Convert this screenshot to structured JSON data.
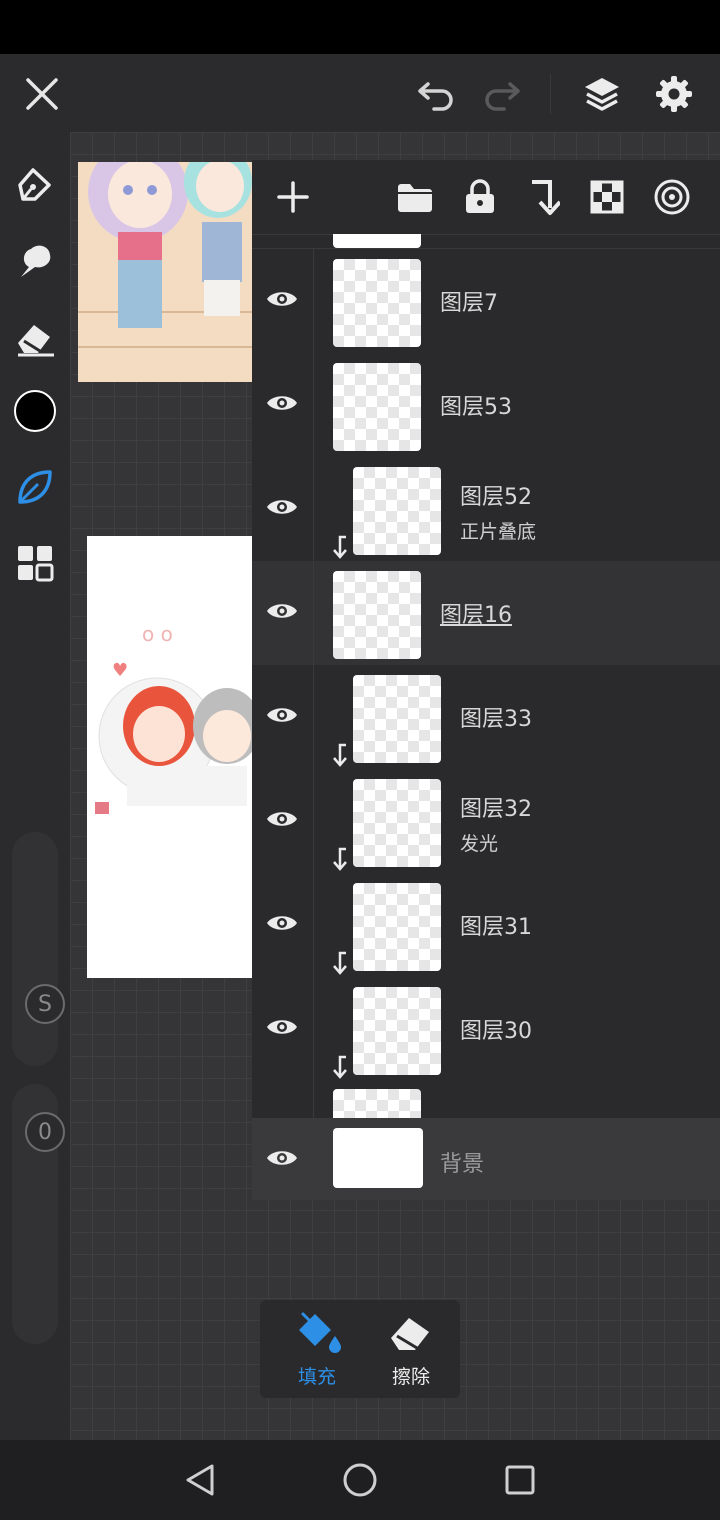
{
  "colors": {
    "accent": "#2d8fe6",
    "current_color": "#000000",
    "panel_bg": "#2a2a2c",
    "canvas_bg": "#353537"
  },
  "topbar": {
    "icons": [
      "close-icon",
      "undo-icon",
      "redo-icon",
      "layers-icon",
      "settings-icon"
    ]
  },
  "left_tools": {
    "icons": [
      "pen-icon",
      "smudge-icon",
      "eraser-icon",
      "color-swatch",
      "leaf-brush-icon",
      "grid-icon"
    ],
    "size_slider_label": "S",
    "opacity_slider_label": "0"
  },
  "layer_panel": {
    "toolbar_icons": [
      "add-layer-icon",
      "folder-icon",
      "lock-icon",
      "clip-icon",
      "transparency-icon",
      "blend-icon"
    ],
    "layers": [
      {
        "name": "图层7",
        "sub": "",
        "clipped": false,
        "selected": false
      },
      {
        "name": "图层53",
        "sub": "",
        "clipped": false,
        "selected": false
      },
      {
        "name": "图层52",
        "sub": "正片叠底",
        "clipped": true,
        "selected": false
      },
      {
        "name": "图层16",
        "sub": "",
        "clipped": false,
        "selected": true
      },
      {
        "name": "图层33",
        "sub": "",
        "clipped": true,
        "selected": false
      },
      {
        "name": "图层32",
        "sub": "发光",
        "clipped": true,
        "selected": false
      },
      {
        "name": "图层31",
        "sub": "",
        "clipped": true,
        "selected": false
      },
      {
        "name": "图层30",
        "sub": "",
        "clipped": true,
        "selected": false
      }
    ],
    "background_layer": "背景"
  },
  "mode": {
    "fill_label": "填充",
    "erase_label": "擦除"
  }
}
